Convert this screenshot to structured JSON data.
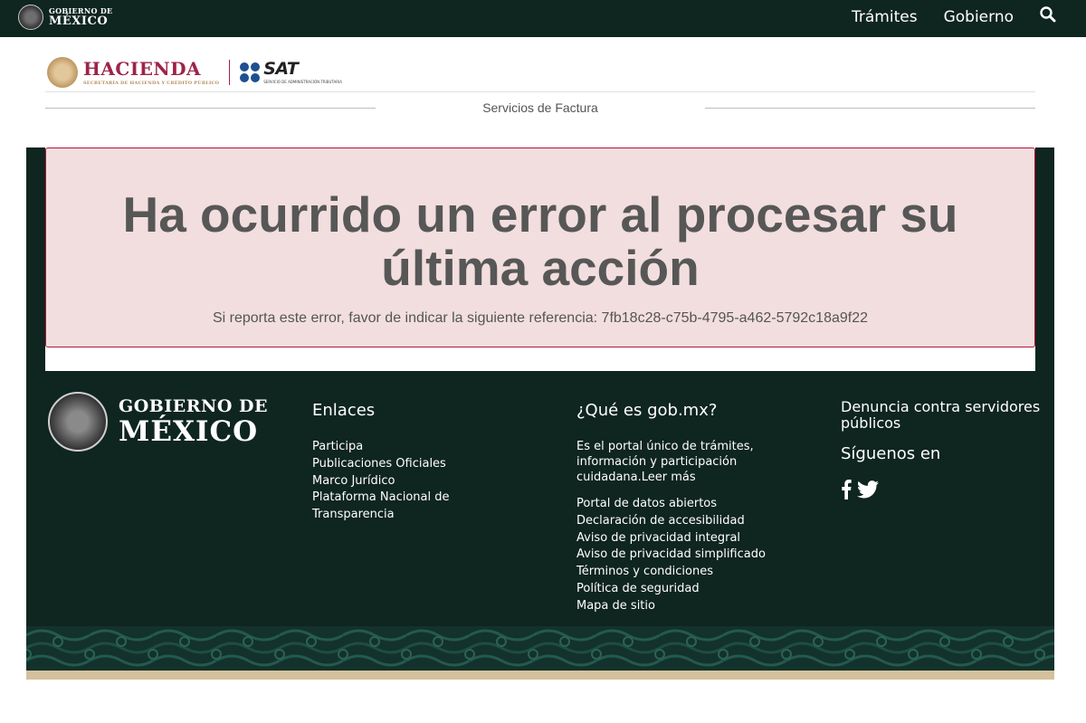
{
  "topnav": {
    "brand_line1": "GOBIERNO DE",
    "brand_line2": "MÉXICO",
    "links": [
      "Trámites",
      "Gobierno"
    ]
  },
  "header": {
    "hacienda_name": "HACIENDA",
    "hacienda_sub": "SECRETARÍA DE HACIENDA Y CRÉDITO PÚBLICO",
    "sat_name": "SAT",
    "sat_sub": "SERVICIO DE ADMINISTRACIÓN TRIBUTARIA",
    "section_title": "Servicios de Factura"
  },
  "error": {
    "title": "Ha ocurrido un error al procesar su última acción",
    "message": "Si reporta este error, favor de indicar la siguiente referencia: 7fb18c28-c75b-4795-a462-5792c18a9f22"
  },
  "footer": {
    "brand_line1": "GOBIERNO DE",
    "brand_line2": "MÉXICO",
    "enlaces": {
      "title": "Enlaces",
      "items": [
        "Participa",
        "Publicaciones Oficiales",
        "Marco Jurídico",
        "Plataforma Nacional de Transparencia"
      ]
    },
    "que_es": {
      "title": "¿Qué es gob.mx?",
      "description": "Es el portal único de trámites, información y participación cuidadana.",
      "read_more": "Leer más",
      "items": [
        "Portal de datos abiertos",
        "Declaración de accesibilidad",
        "Aviso de privacidad integral",
        "Aviso de privacidad simplificado",
        "Términos y condiciones",
        "Política de seguridad",
        "Mapa de sitio"
      ]
    },
    "denuncia": "Denuncia contra servidores públicos",
    "siguenos": "Síguenos en"
  },
  "colors": {
    "nav_bg": "#0f2520",
    "error_bg": "#f2dede",
    "error_border": "#b0163b",
    "hacienda_red": "#9d2449",
    "sat_blue": "#1d4f91",
    "footer_tan": "#d4c19c"
  }
}
